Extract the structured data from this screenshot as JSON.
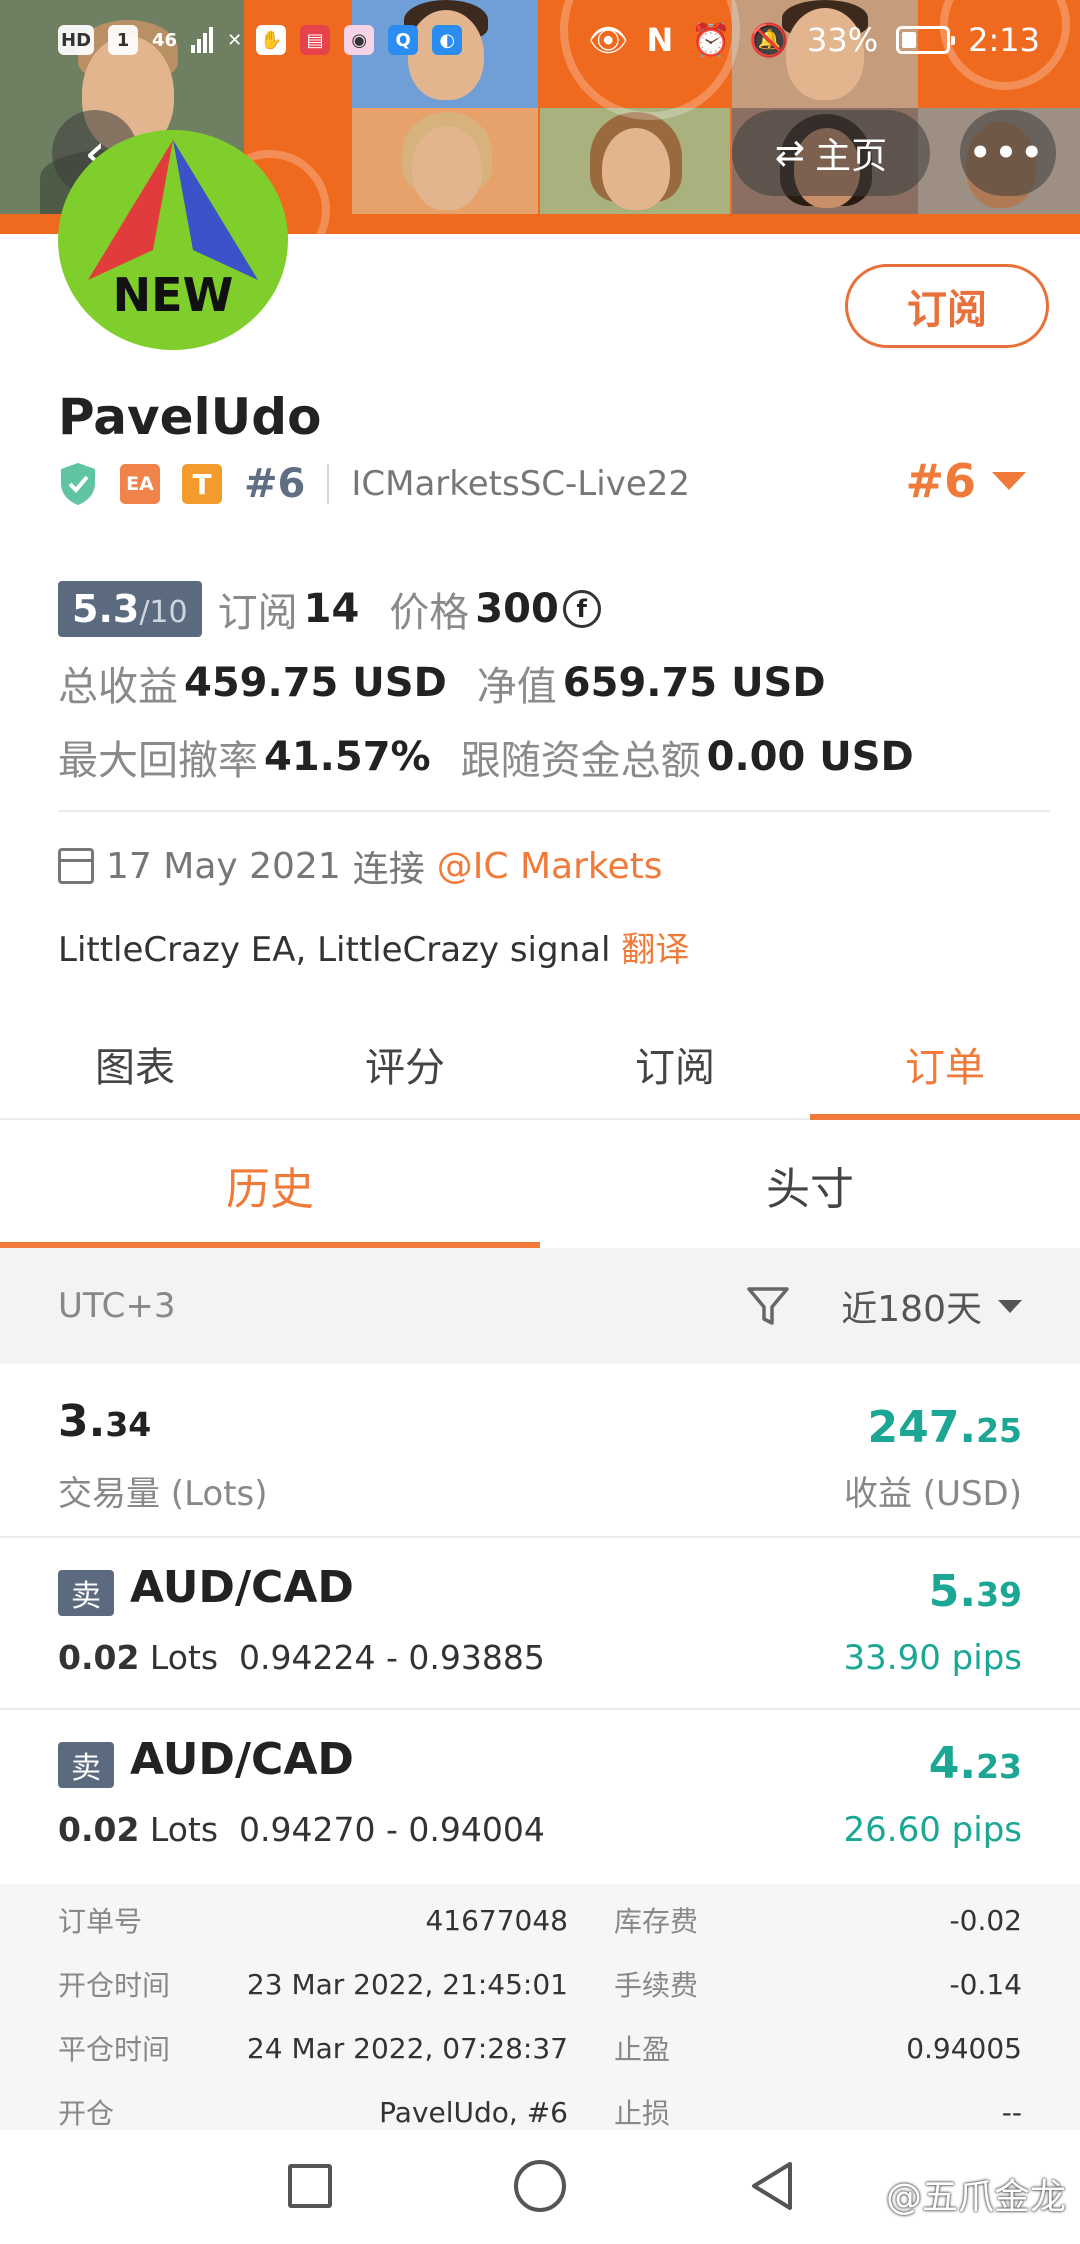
{
  "statusbar": {
    "left_chips": [
      "HD",
      "1",
      "46",
      "✕"
    ],
    "battery": "33%",
    "time": "2:13"
  },
  "header": {
    "home_label": "主页",
    "more_label": "•••"
  },
  "profile": {
    "avatar_text": "NEW",
    "name": "PavelUdo",
    "badges": [
      "EA",
      "T"
    ],
    "rank": "#6",
    "server": "ICMarketsSC-Live22",
    "rank_right": "#6",
    "subscribe_label": "订阅"
  },
  "stats": {
    "score": "5.3",
    "score_denominator": "/10",
    "subscriptions_label": "订阅",
    "subscriptions_value": "14",
    "price_label": "价格",
    "price_value": "300",
    "price_currency_symbol": "f",
    "total_profit_label": "总收益",
    "total_profit_value": "459.75 USD",
    "equity_label": "净值",
    "equity_value": "659.75 USD",
    "max_drawdown_label": "最大回撤率",
    "max_drawdown_value": "41.57%",
    "followers_funds_label": "跟随资金总额",
    "followers_funds_value": "0.00 USD"
  },
  "connection": {
    "date": "17 May 2021",
    "connect_label": "连接",
    "broker_link": "@IC Markets"
  },
  "description": {
    "text": "LittleCrazy EA, LittleCrazy signal",
    "translate_label": "翻译"
  },
  "tabs": [
    "图表",
    "评分",
    "订阅",
    "订单"
  ],
  "active_tab": 3,
  "subtabs": [
    "历史",
    "头寸"
  ],
  "active_subtab": 0,
  "filter": {
    "timezone": "UTC+3",
    "period": "近180天"
  },
  "summary": {
    "volume_int": "3.",
    "volume_dec": "34",
    "volume_label": "交易量 (Lots)",
    "profit_int": "247.",
    "profit_dec": "25",
    "profit_label": "收益 (USD)"
  },
  "trades": [
    {
      "side": "卖",
      "pair": "AUD/CAD",
      "lots": "0.02",
      "lots_unit": "Lots",
      "prices": "0.94224 - 0.93885",
      "pnl_int": "5.",
      "pnl_dec": "39",
      "pips": "33.90 pips"
    },
    {
      "side": "卖",
      "pair": "AUD/CAD",
      "lots": "0.02",
      "lots_unit": "Lots",
      "prices": "0.94270 - 0.94004",
      "pnl_int": "4.",
      "pnl_dec": "23",
      "pips": "26.60 pips"
    }
  ],
  "details": [
    {
      "label": "订单号",
      "value": "41677048",
      "label2": "库存费",
      "value2": "-0.02"
    },
    {
      "label": "开仓时间",
      "value": "23 Mar 2022, 21:45:01",
      "label2": "手续费",
      "value2": "-0.14"
    },
    {
      "label": "平仓时间",
      "value": "24 Mar 2022, 07:28:37",
      "label2": "止盈",
      "value2": "0.94005"
    },
    {
      "label": "开仓",
      "value": "PavelUdo, #6",
      "label2": "止损",
      "value2": "--"
    }
  ],
  "watermark": "@五爪金龙",
  "colors": {
    "accent": "#ef7a3a",
    "profit": "#1ba794",
    "tag": "#5c6a80",
    "banner": "#ef6a1e"
  }
}
